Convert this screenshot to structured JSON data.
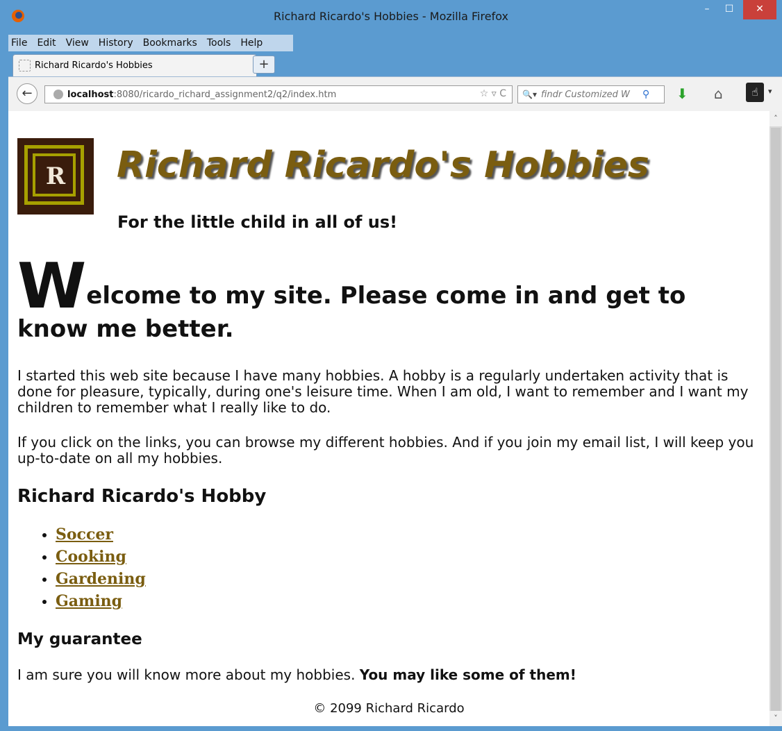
{
  "window": {
    "title": "Richard Ricardo's Hobbies - Mozilla Firefox",
    "minimize_glyph": "–",
    "maximize_glyph": "☐",
    "close_glyph": "✕"
  },
  "menu": {
    "file": "File",
    "edit": "Edit",
    "view": "View",
    "history": "History",
    "bookmarks": "Bookmarks",
    "tools": "Tools",
    "help": "Help"
  },
  "tab": {
    "label": "Richard Ricardo's Hobbies",
    "new_tab_glyph": "+"
  },
  "navbar": {
    "url_host": "localhost",
    "url_rest": ":8080/ricardo_richard_assignment2/q2/index.htm",
    "url_tools": "☆ ▿ C",
    "search_placeholder": "findr Customized W"
  },
  "page": {
    "logo_letter": "R",
    "site_title": "Richard Ricardo's Hobbies",
    "tagline": "For the little child in all of us!",
    "welcome_drop": "W",
    "welcome_rest": "elcome to my site. Please come in and get to know me better.",
    "para1": "I started this web site because I have many hobbies. A hobby is a regularly undertaken activity that is done for pleasure, typically, during one's leisure time. When I am old, I want to remember and I want my children to remember what I really like to do.",
    "para2": "If you click on the links, you can browse my different hobbies. And if you join my email list, I will keep you up-to-date on all my hobbies.",
    "hobby_heading": "Richard Ricardo's Hobby",
    "hobbies": [
      "Soccer",
      "Cooking",
      "Gardening",
      "Gaming"
    ],
    "guarantee_heading": "My guarantee",
    "guarantee_text": "I am sure you will know more about my hobbies.",
    "guarantee_bold": "You may like some of them!",
    "footer": "© 2099 Richard Ricardo"
  },
  "colors": {
    "accent": "#7a5d10",
    "logo_bg": "#3a1c0c",
    "logo_ring": "#a7a000",
    "chrome": "#5b9bd0"
  },
  "icons": [
    "firefox-icon",
    "back-arrow-icon",
    "globe-icon",
    "bookmark-star-icon",
    "search-engine-icon",
    "magnifier-icon",
    "download-icon",
    "home-icon",
    "hand-pointer-icon"
  ]
}
